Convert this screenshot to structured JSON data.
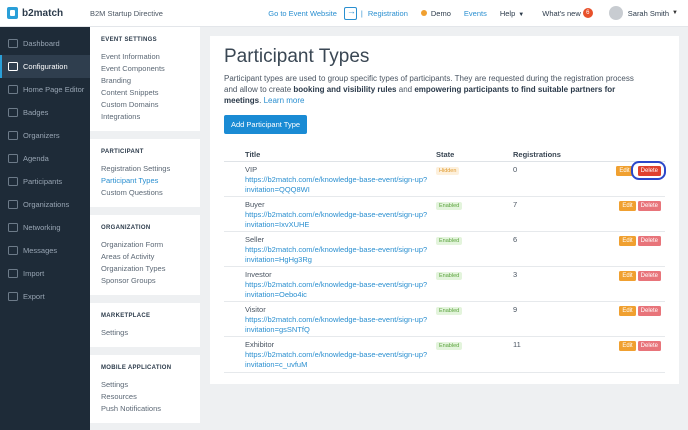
{
  "topbar": {
    "logo_text": "b2match",
    "event_name": "B2M Startup Directive",
    "goto_label": "Go to Event Website",
    "divider": "|",
    "registration_label": "Registration",
    "demo_label": "Demo",
    "events_label": "Events",
    "help_label": "Help",
    "whatsnew_label": "What's new",
    "whatsnew_count": "6",
    "user_name": "Sarah Smith"
  },
  "sidebar": {
    "items": [
      {
        "label": "Dashboard",
        "icon": "dashboard-icon"
      },
      {
        "label": "Configuration",
        "icon": "gear-icon"
      },
      {
        "label": "Home Page Editor",
        "icon": "home-icon"
      },
      {
        "label": "Badges",
        "icon": "badge-icon"
      },
      {
        "label": "Organizers",
        "icon": "organizers-icon"
      },
      {
        "label": "Agenda",
        "icon": "agenda-icon"
      },
      {
        "label": "Participants",
        "icon": "participants-icon"
      },
      {
        "label": "Organizations",
        "icon": "organizations-icon"
      },
      {
        "label": "Networking",
        "icon": "networking-icon"
      },
      {
        "label": "Messages",
        "icon": "messages-icon"
      },
      {
        "label": "Import",
        "icon": "import-icon"
      },
      {
        "label": "Export",
        "icon": "export-icon"
      }
    ]
  },
  "submenu": {
    "event_settings": {
      "heading": "EVENT SETTINGS",
      "links": [
        "Event Information",
        "Event Components",
        "Branding",
        "Content Snippets",
        "Custom Domains",
        "Integrations"
      ]
    },
    "participant": {
      "heading": "PARTICIPANT",
      "links": [
        "Registration Settings",
        "Participant Types",
        "Custom Questions"
      ]
    },
    "organization": {
      "heading": "ORGANIZATION",
      "links": [
        "Organization Form",
        "Areas of Activity",
        "Organization Types",
        "Sponsor Groups"
      ]
    },
    "marketplace": {
      "heading": "MARKETPLACE",
      "links": [
        "Settings"
      ]
    },
    "mobile_application": {
      "heading": "MOBILE APPLICATION",
      "links": [
        "Settings",
        "Resources",
        "Push Notifications"
      ]
    }
  },
  "main": {
    "title": "Participant Types",
    "desc_1": "Participant types are used to group specific types of participants. They are requested during the registration process and allow to create ",
    "desc_bold_1": "booking and visibility rules",
    "desc_2": " and ",
    "desc_bold_2": "empowering participants to find suitable partners for meetings",
    "desc_3": ". ",
    "learn_more": "Learn more",
    "add_button": "Add Participant Type",
    "columns": {
      "title": "Title",
      "state": "State",
      "registrations": "Registrations"
    },
    "edit_label": "Edit",
    "delete_label": "Delete",
    "rows": [
      {
        "title": "VIP",
        "url": "https://b2match.com/e/knowledge-base-event/sign-up?invitation=QQQ8WI",
        "state": "Hidden",
        "registrations": "0"
      },
      {
        "title": "Buyer",
        "url": "https://b2match.com/e/knowledge-base-event/sign-up?invitation=IxvXUHE",
        "state": "Enabled",
        "registrations": "7"
      },
      {
        "title": "Seller",
        "url": "https://b2match.com/e/knowledge-base-event/sign-up?invitation=HgHg3Rg",
        "state": "Enabled",
        "registrations": "6"
      },
      {
        "title": "Investor",
        "url": "https://b2match.com/e/knowledge-base-event/sign-up?invitation=Oebo4ic",
        "state": "Enabled",
        "registrations": "3"
      },
      {
        "title": "Visitor",
        "url": "https://b2match.com/e/knowledge-base-event/sign-up?invitation=gsSNTfQ",
        "state": "Enabled",
        "registrations": "9"
      },
      {
        "title": "Exhibitor",
        "url": "https://b2match.com/e/knowledge-base-event/sign-up?invitation=c_uvfuM",
        "state": "Enabled",
        "registrations": "11"
      }
    ]
  }
}
